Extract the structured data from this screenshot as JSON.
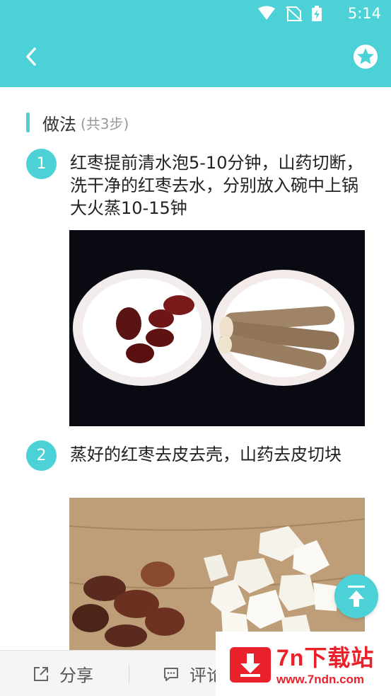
{
  "status_bar": {
    "time": "5:14"
  },
  "header": {
    "accent_color": "#4cd1d6",
    "back_icon": "chevron-left-icon",
    "favorite_icon": "star-icon"
  },
  "section": {
    "title": "做法",
    "count": "(共3步)"
  },
  "steps": [
    {
      "number": "1",
      "text": "红枣提前清水泡5-10分钟，山药切断，洗干净的红枣去水，分别放入碗中上锅大火蒸10-15钟"
    },
    {
      "number": "2",
      "text": "蒸好的红枣去皮去壳，山药去皮切块"
    }
  ],
  "bottom_bar": {
    "share_label": "分享",
    "comment_label": "评论"
  },
  "watermark": {
    "title": "7n下载站",
    "url": "www.7ndn.com"
  }
}
